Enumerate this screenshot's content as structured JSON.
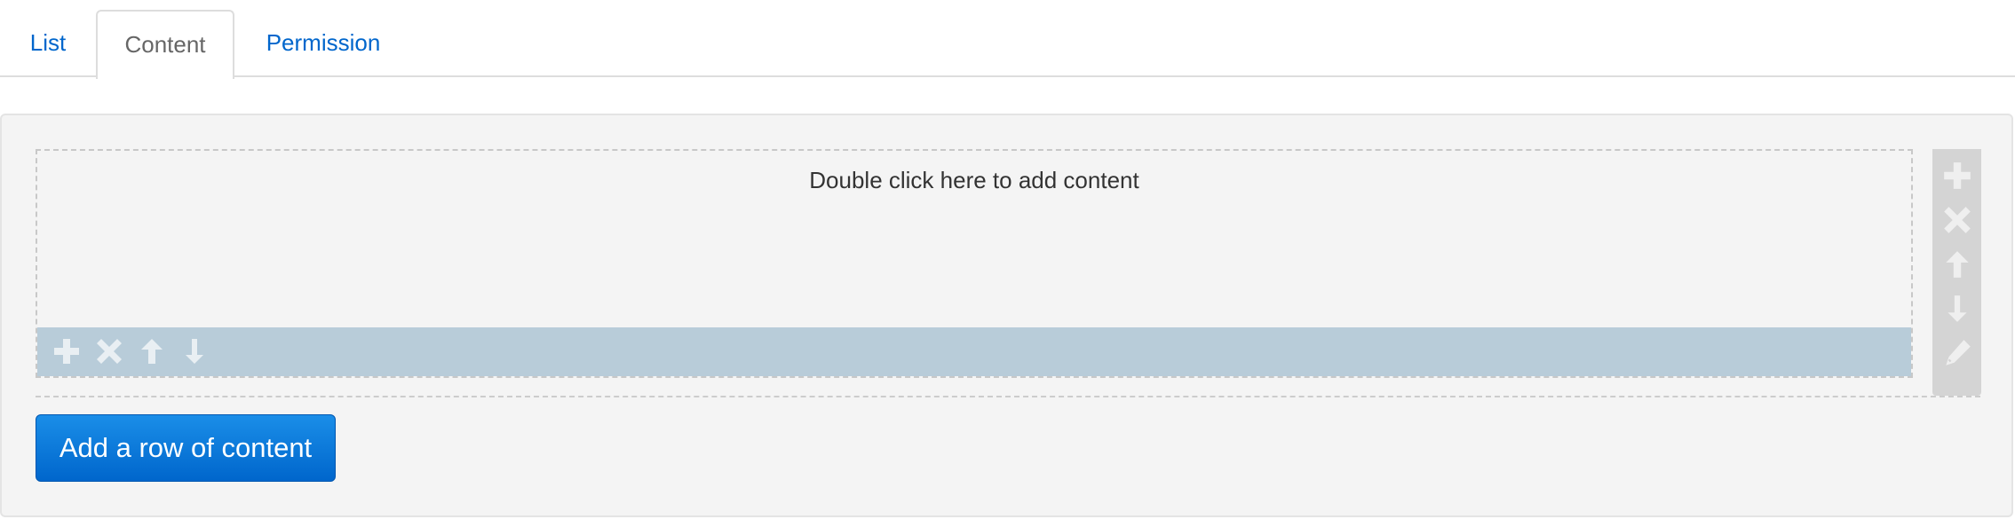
{
  "tabs": [
    {
      "label": "List",
      "active": false
    },
    {
      "label": "Content",
      "active": true
    },
    {
      "label": "Permission",
      "active": false
    }
  ],
  "editor": {
    "block_hint": "Double click here to add content",
    "block_tools": [
      "plus-icon",
      "close-icon",
      "arrow-up-icon",
      "arrow-down-icon"
    ],
    "row_tools": [
      "plus-icon",
      "close-icon",
      "arrow-up-icon",
      "arrow-down-icon",
      "pencil-icon"
    ],
    "add_row_label": "Add a row of content"
  },
  "colors": {
    "link": "#0066cc",
    "active_tab_text": "#666666",
    "panel_bg": "#f4f4f4",
    "block_toolbar_bg": "#b8ccd9",
    "row_toolbar_bg": "#d4d4d4",
    "button_bg": "#0a7ad8"
  }
}
